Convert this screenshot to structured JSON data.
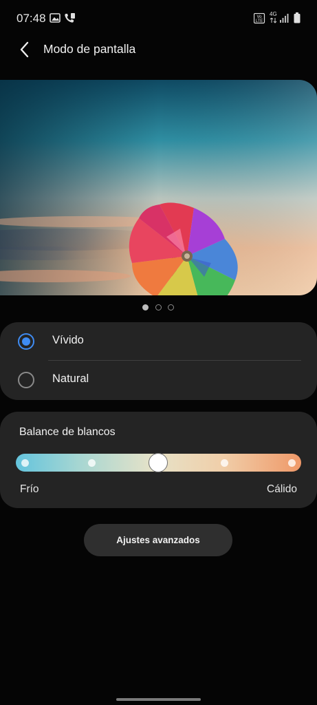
{
  "status_bar": {
    "time": "07:48",
    "network": "4G",
    "volte": "Vo LTE",
    "icons": [
      "image-icon",
      "wifi-calling-icon",
      "volte-icon",
      "network-4g-icon",
      "signal-icon",
      "battery-icon"
    ]
  },
  "header": {
    "title": "Modo de pantalla",
    "back_icon": "back-arrow-icon"
  },
  "preview": {
    "image": "pinwheel-photo",
    "page_count": 3,
    "active_page": 1
  },
  "screen_mode": {
    "options": [
      {
        "label": "Vívido",
        "selected": true
      },
      {
        "label": "Natural",
        "selected": false
      }
    ],
    "accent_color": "#3f8cf3"
  },
  "white_balance": {
    "title": "Balance de blancos",
    "left_label": "Frío",
    "right_label": "Cálido",
    "steps": 5,
    "selected_step": 3
  },
  "advanced_button": {
    "label": "Ajustes avanzados"
  }
}
